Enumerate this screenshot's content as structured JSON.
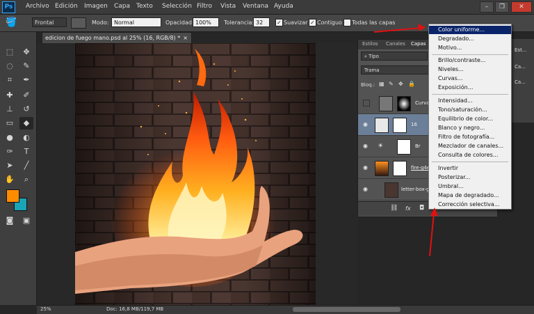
{
  "menubar": {
    "app_logo": "Ps",
    "items": [
      "Archivo",
      "Edición",
      "Imagen",
      "Capa",
      "Texto",
      "Selección",
      "Filtro",
      "Vista",
      "Ventana",
      "Ayuda"
    ]
  },
  "options": {
    "preset": "Frontal",
    "mode_label": "Modo:",
    "mode_value": "Normal",
    "opacity_label": "Opacidad:",
    "opacity_value": "100%",
    "tolerance_label": "Tolerancia:",
    "tolerance_value": "32",
    "antialias_label": "Suavizar",
    "contiguous_label": "Contiguo",
    "all_layers_label": "Todas las capas"
  },
  "document": {
    "tab_title": "edicion de fuego mano.psd al 25% (16, RGB/8) *",
    "close": "×"
  },
  "status": {
    "zoom": "25%",
    "doc_info": "Doc: 16,8 MB/119,7 MB"
  },
  "panel": {
    "tabs": [
      "Estilos",
      "Canales",
      "Capas"
    ],
    "filter_label": "Tipo",
    "blend_mode": "Trama",
    "lock_label": "Bloq.:",
    "layers": [
      {
        "name": "Curva"
      },
      {
        "name": "16"
      },
      {
        "name": "Br"
      },
      {
        "name": "fire-g4e"
      },
      {
        "name": "letter-box-g1"
      }
    ],
    "footer_icons": [
      "link-icon",
      "fx-icon",
      "mask-icon"
    ],
    "footer_fx": "fx"
  },
  "rightstrip": {
    "items": [
      "Est...",
      "Ca...",
      "Ca..."
    ]
  },
  "context_menu": {
    "group1": [
      "Color uniforme...",
      "Degradado...",
      "Motivo..."
    ],
    "group2": [
      "Brillo/contraste...",
      "Niveles...",
      "Curvas...",
      "Exposición..."
    ],
    "group3": [
      "Intensidad...",
      "Tono/saturación...",
      "Equilibrio de color...",
      "Blanco y negro...",
      "Filtro de fotografía...",
      "Mezclador de canales...",
      "Consulta de colores..."
    ],
    "group4": [
      "Invertir",
      "Posterizar...",
      "Umbral...",
      "Mapa de degradado...",
      "Corrección selectiva..."
    ]
  },
  "colors": {
    "foreground": "#ff8c00",
    "background": "#1aa4b8",
    "highlight": "#0a246a",
    "arrow": "#e01010"
  }
}
